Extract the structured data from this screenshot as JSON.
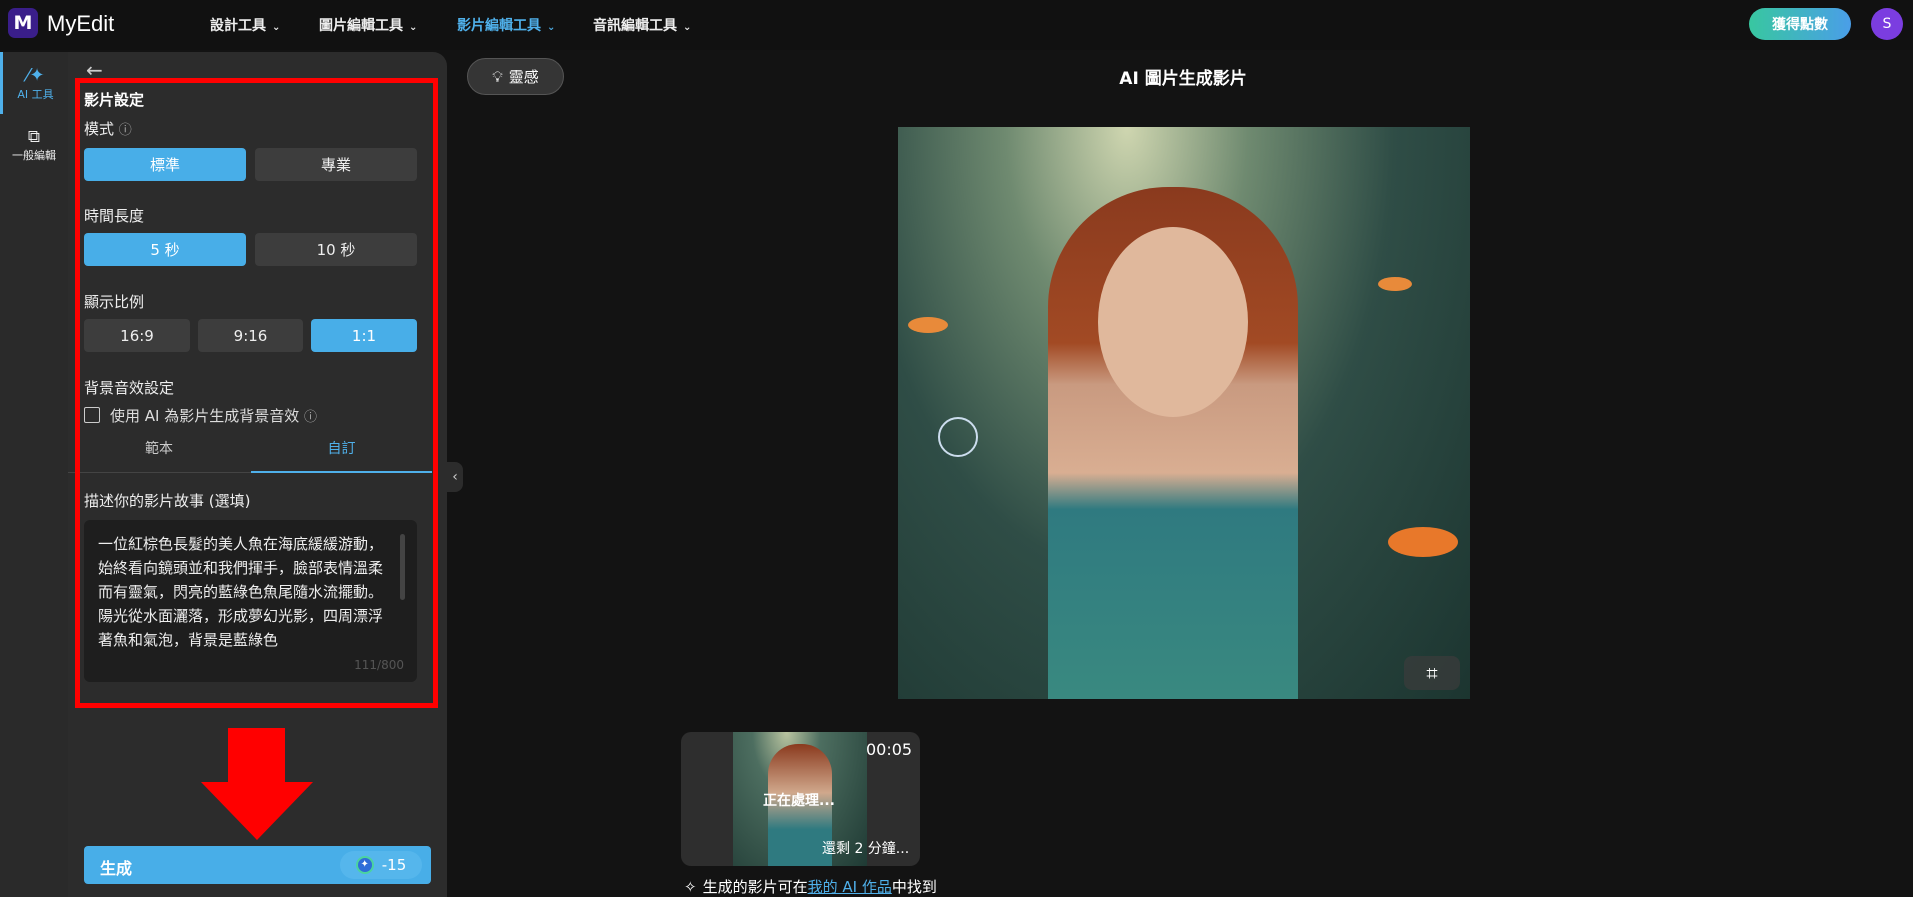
{
  "header": {
    "logo_letter": "M",
    "brand": "MyEdit",
    "nav": [
      {
        "label": "設計工具"
      },
      {
        "label": "圖片編輯工具"
      },
      {
        "label": "影片編輯工具",
        "active": true
      },
      {
        "label": "音訊編輯工具"
      }
    ],
    "points_label": "獲得點數",
    "avatar_initial": "S"
  },
  "rail": {
    "items": [
      {
        "label": "AI 工具",
        "icon": "magic-wand-icon"
      },
      {
        "label": "一般編輯",
        "icon": "layers-icon"
      }
    ]
  },
  "settings": {
    "title": "影片設定",
    "mode": {
      "label": "模式",
      "options": [
        "標準",
        "專業"
      ],
      "selected": "標準"
    },
    "duration": {
      "label": "時間長度",
      "options": [
        "5 秒",
        "10 秒"
      ],
      "selected": "5 秒"
    },
    "ratio": {
      "label": "顯示比例",
      "options": [
        "16:9",
        "9:16",
        "1:1"
      ],
      "selected": "1:1"
    },
    "bgm": {
      "label": "背景音效設定",
      "checkbox_label": "使用 AI 為影片生成背景音效",
      "checked": false
    },
    "tabs": [
      "範本",
      "自訂"
    ],
    "active_tab": "自訂",
    "story": {
      "label": "描述你的影片故事 (選填)",
      "value": "一位紅棕色長髮的美人魚在海底緩緩游動，始終看向鏡頭並和我們揮手，臉部表情溫柔而有靈氣，閃亮的藍綠色魚尾隨水流擺動。陽光從水面灑落，形成夢幻光影，四周漂浮著魚和氣泡，背景是藍綠色",
      "counter": "111/800"
    },
    "generate": {
      "label": "生成",
      "cost": "-15"
    }
  },
  "main": {
    "inspiration_label": "靈感",
    "title": "AI 圖片生成影片",
    "job": {
      "duration": "00:05",
      "status": "正在處理...",
      "remaining": "還剩 2 分鐘..."
    },
    "footer": {
      "prefix": "生成的影片可在",
      "link": "我的 AI 作品",
      "suffix": "中找到"
    }
  },
  "colors": {
    "accent": "#48aee8",
    "annotation": "#ff0000"
  }
}
